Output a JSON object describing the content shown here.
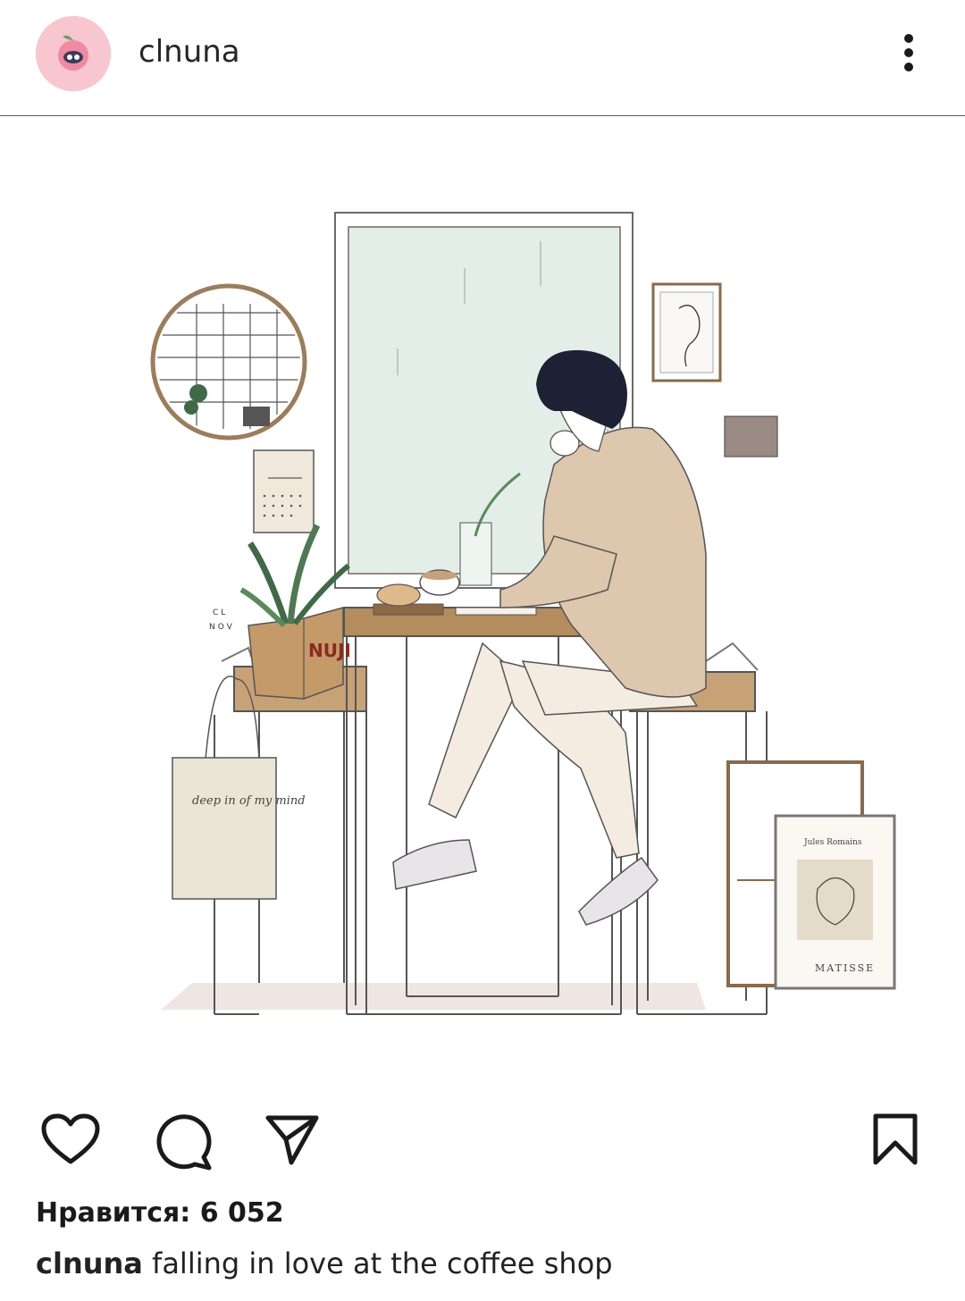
{
  "header": {
    "username": "clnuna",
    "avatar_icon": "peach-avatar-icon",
    "more_icon": "vertical-dots-icon"
  },
  "post": {
    "image_description_icon": "illustration",
    "artwork_texts": {
      "signature_line1": "CL",
      "signature_line2": "NOV",
      "bag_text": "deep in of my mind",
      "poster_author": "Jules Romains",
      "poster_title": "MATISSE",
      "box_brand": "NUJI"
    }
  },
  "actions": {
    "like_icon": "heart-icon",
    "comment_icon": "comment-icon",
    "share_icon": "send-icon",
    "save_icon": "bookmark-icon"
  },
  "likes": {
    "label": "Нравится: 6 052"
  },
  "caption": {
    "username": "clnuna",
    "text": "falling in love at the coffee shop"
  },
  "colors": {
    "avatar_bg": "#f7c6cf",
    "window_glass": "#e6efe9",
    "wood": "#b08a5e",
    "sweater": "#ddc7ad",
    "hair": "#1e2033"
  }
}
